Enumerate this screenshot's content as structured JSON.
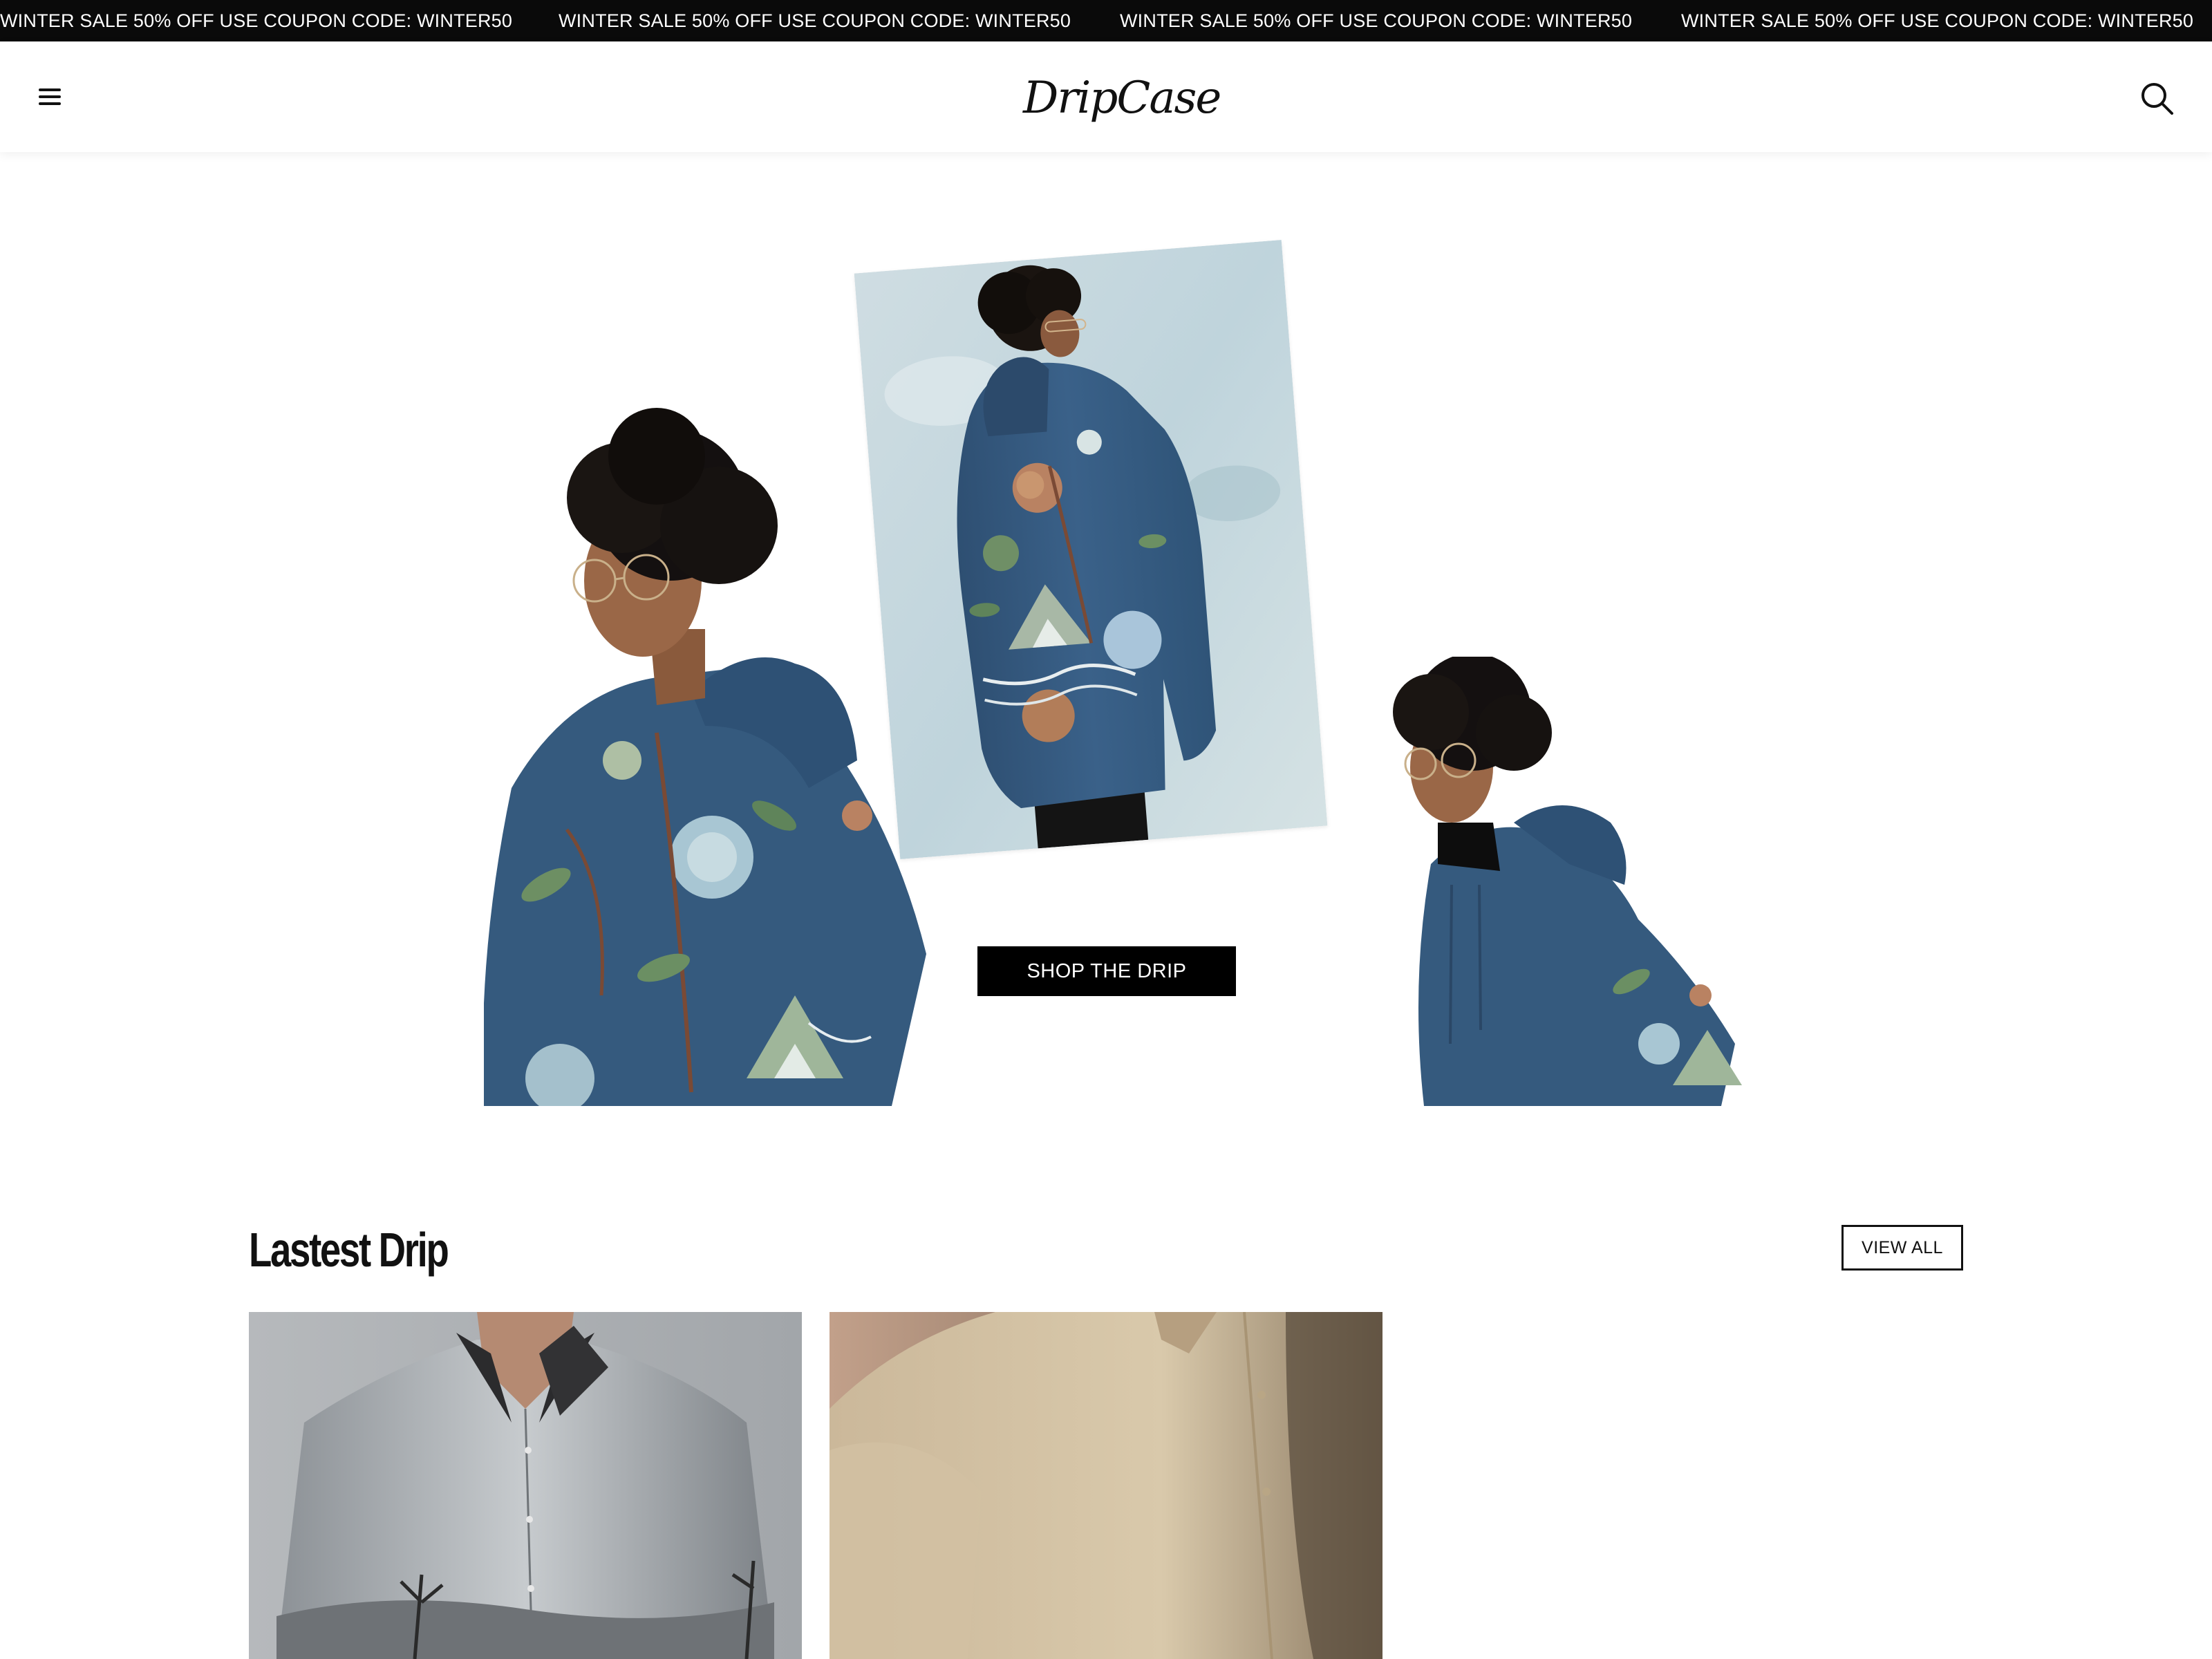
{
  "announcement": {
    "items": [
      "WINTER SALE 50% OFF USE COUPON CODE: WINTER50",
      "WINTER SALE 50% OFF USE COUPON CODE: WINTER50",
      "WINTER SALE 50% OFF USE COUPON CODE: WINTER50",
      "WINTER SALE 50% OFF USE COUPON CODE: WINTER50"
    ]
  },
  "header": {
    "logo": "DripCase",
    "menu_icon": "hamburger-menu-icon",
    "search_icon": "search-icon"
  },
  "hero": {
    "cta_label": "SHOP THE DRIP"
  },
  "latest": {
    "title": "Lastest Drip",
    "view_all_label": "VIEW ALL"
  },
  "colors": {
    "announcement_bg": "#0a0a0a",
    "hoodie_blue": "#355a7e",
    "cta_bg": "#000000"
  }
}
